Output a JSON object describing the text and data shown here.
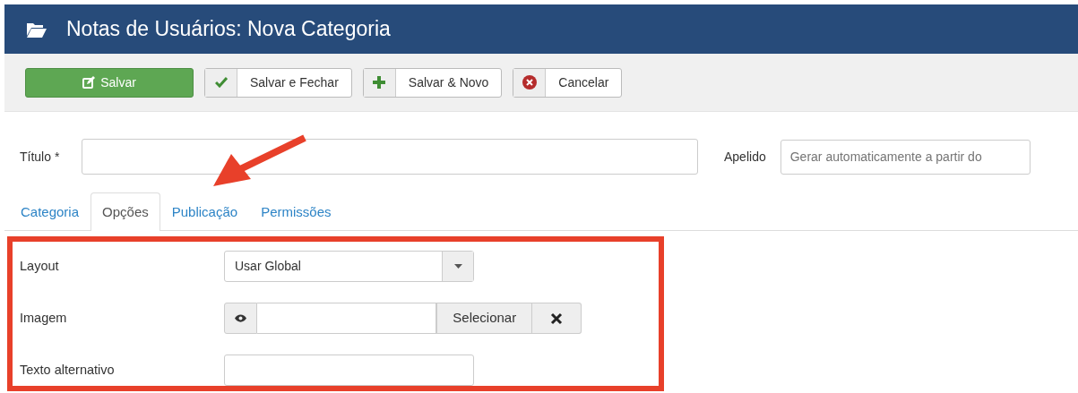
{
  "header": {
    "title": "Notas de Usuários: Nova Categoria"
  },
  "toolbar": [
    {
      "label": "Salvar",
      "kind": "edit",
      "primary": true
    },
    {
      "label": "Salvar e Fechar",
      "kind": "check",
      "primary": false
    },
    {
      "label": "Salvar & Novo",
      "kind": "plus",
      "primary": false
    },
    {
      "label": "Cancelar",
      "kind": "cancel",
      "primary": false
    }
  ],
  "title_field": {
    "label": "Título *"
  },
  "alias_field": {
    "label": "Apelido",
    "placeholder": "Gerar automaticamente a partir do"
  },
  "tabs": [
    {
      "label": "Categoria",
      "selected": false
    },
    {
      "label": "Opções",
      "selected": true
    },
    {
      "label": "Publicação",
      "selected": false
    },
    {
      "label": "Permissões",
      "selected": false
    }
  ],
  "fields": [
    {
      "kind": "select",
      "label": "Layout",
      "value": "Usar Global"
    },
    {
      "kind": "image",
      "label": "Imagem",
      "button": "Selecionar"
    },
    {
      "kind": "text",
      "label": "Texto alternativo"
    }
  ]
}
